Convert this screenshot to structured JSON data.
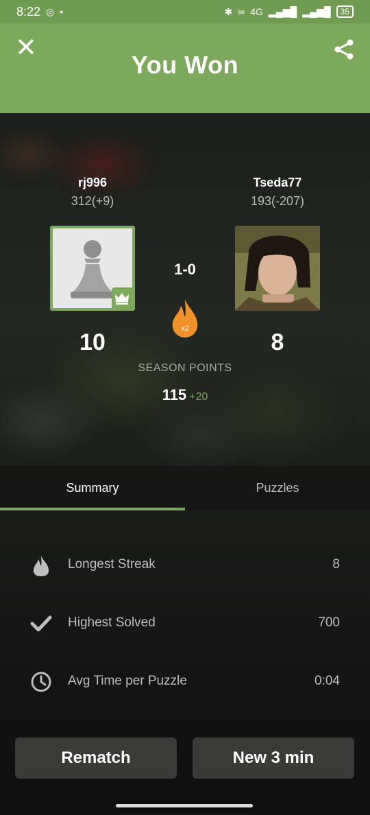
{
  "status_bar": {
    "time": "8:22",
    "network": "4G",
    "battery": "35"
  },
  "header": {
    "title": "You Won",
    "close_icon": "close-icon",
    "share_icon": "share-icon",
    "color": "#7ca95b"
  },
  "players": {
    "left": {
      "name": "rj996",
      "rating": "312(+9)",
      "points": "10",
      "avatar": "pawn-avatar"
    },
    "right": {
      "name": "Tseda77",
      "rating": "193(-207)",
      "points": "8",
      "avatar": "photo-avatar"
    }
  },
  "result": {
    "score": "1-0",
    "multiplier": "x2"
  },
  "season": {
    "label": "SEASON POINTS",
    "total": "115",
    "delta": "+20"
  },
  "tabs": [
    {
      "label": "Summary",
      "active": true
    },
    {
      "label": "Puzzles",
      "active": false
    }
  ],
  "stats": [
    {
      "icon": "flame-icon",
      "label": "Longest Streak",
      "value": "8"
    },
    {
      "icon": "checkmark-icon",
      "label": "Highest Solved",
      "value": "700"
    },
    {
      "icon": "clock-icon",
      "label": "Avg Time per Puzzle",
      "value": "0:04"
    }
  ],
  "buttons": {
    "rematch": "Rematch",
    "new_game": "New 3 min"
  },
  "colors": {
    "accent": "#7ca95b",
    "flame": "#f0922a",
    "button_bg": "#3a3a39"
  }
}
